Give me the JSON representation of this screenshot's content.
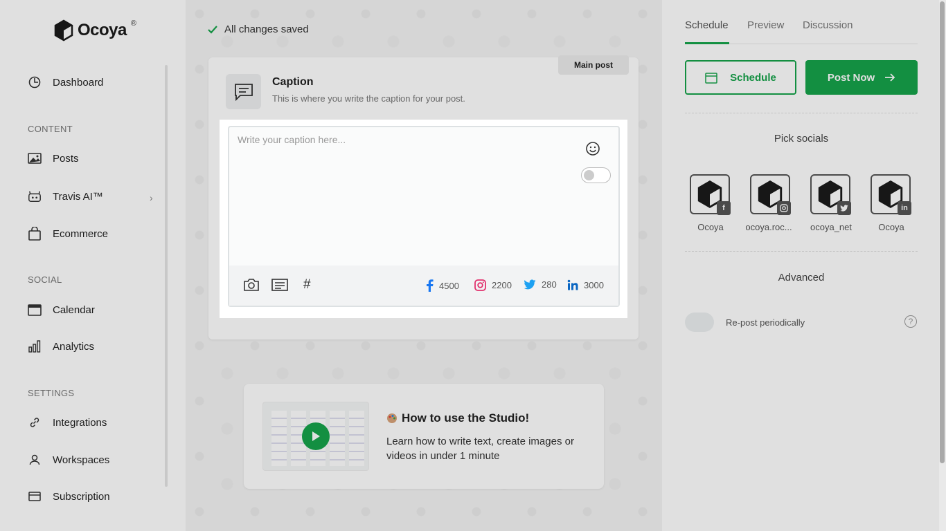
{
  "app": {
    "name": "Ocoya",
    "reg": "®"
  },
  "sidebar": {
    "items": [
      {
        "label": "Dashboard",
        "icon": "dashboard-icon"
      },
      {
        "label": "Posts",
        "icon": "image-icon"
      },
      {
        "label": "Travis AI™",
        "icon": "robot-icon"
      },
      {
        "label": "Ecommerce",
        "icon": "bag-icon"
      },
      {
        "label": "Calendar",
        "icon": "calendar-icon"
      },
      {
        "label": "Analytics",
        "icon": "bar-chart-icon"
      },
      {
        "label": "Integrations",
        "icon": "link-icon"
      },
      {
        "label": "Workspaces",
        "icon": "user-icon"
      },
      {
        "label": "Subscription",
        "icon": "card-icon"
      }
    ],
    "sections": {
      "content": "CONTENT",
      "social": "SOCIAL",
      "settings": "SETTINGS"
    }
  },
  "main": {
    "saved_status": "All changes saved",
    "tag": "Main post",
    "caption": {
      "title": "Caption",
      "subtitle": "This is where you write the caption for your post.",
      "placeholder": "Write your caption here..."
    },
    "counters": [
      {
        "network": "facebook",
        "value": "4500",
        "color": "#1877f2"
      },
      {
        "network": "instagram",
        "value": "2200",
        "color": "#e1306c"
      },
      {
        "network": "twitter",
        "value": "280",
        "color": "#1da1f2"
      },
      {
        "network": "linkedin",
        "value": "3000",
        "color": "#0a66c2"
      }
    ],
    "video": {
      "title": "How to use the Studio!",
      "description": "Learn how to write text, create images or videos in under 1 minute"
    }
  },
  "right": {
    "tabs": [
      "Schedule",
      "Preview",
      "Discussion"
    ],
    "schedule_button": "Schedule",
    "post_now_button": "Post Now",
    "pick_socials": "Pick socials",
    "socials": [
      {
        "name": "Ocoya",
        "network": "facebook"
      },
      {
        "name": "ocoya.roc...",
        "network": "instagram"
      },
      {
        "name": "ocoya_net",
        "network": "twitter"
      },
      {
        "name": "Ocoya",
        "network": "linkedin"
      }
    ],
    "advanced": "Advanced",
    "repost": "Re-post periodically",
    "help": "?"
  },
  "colors": {
    "accent": "#16a34a"
  }
}
